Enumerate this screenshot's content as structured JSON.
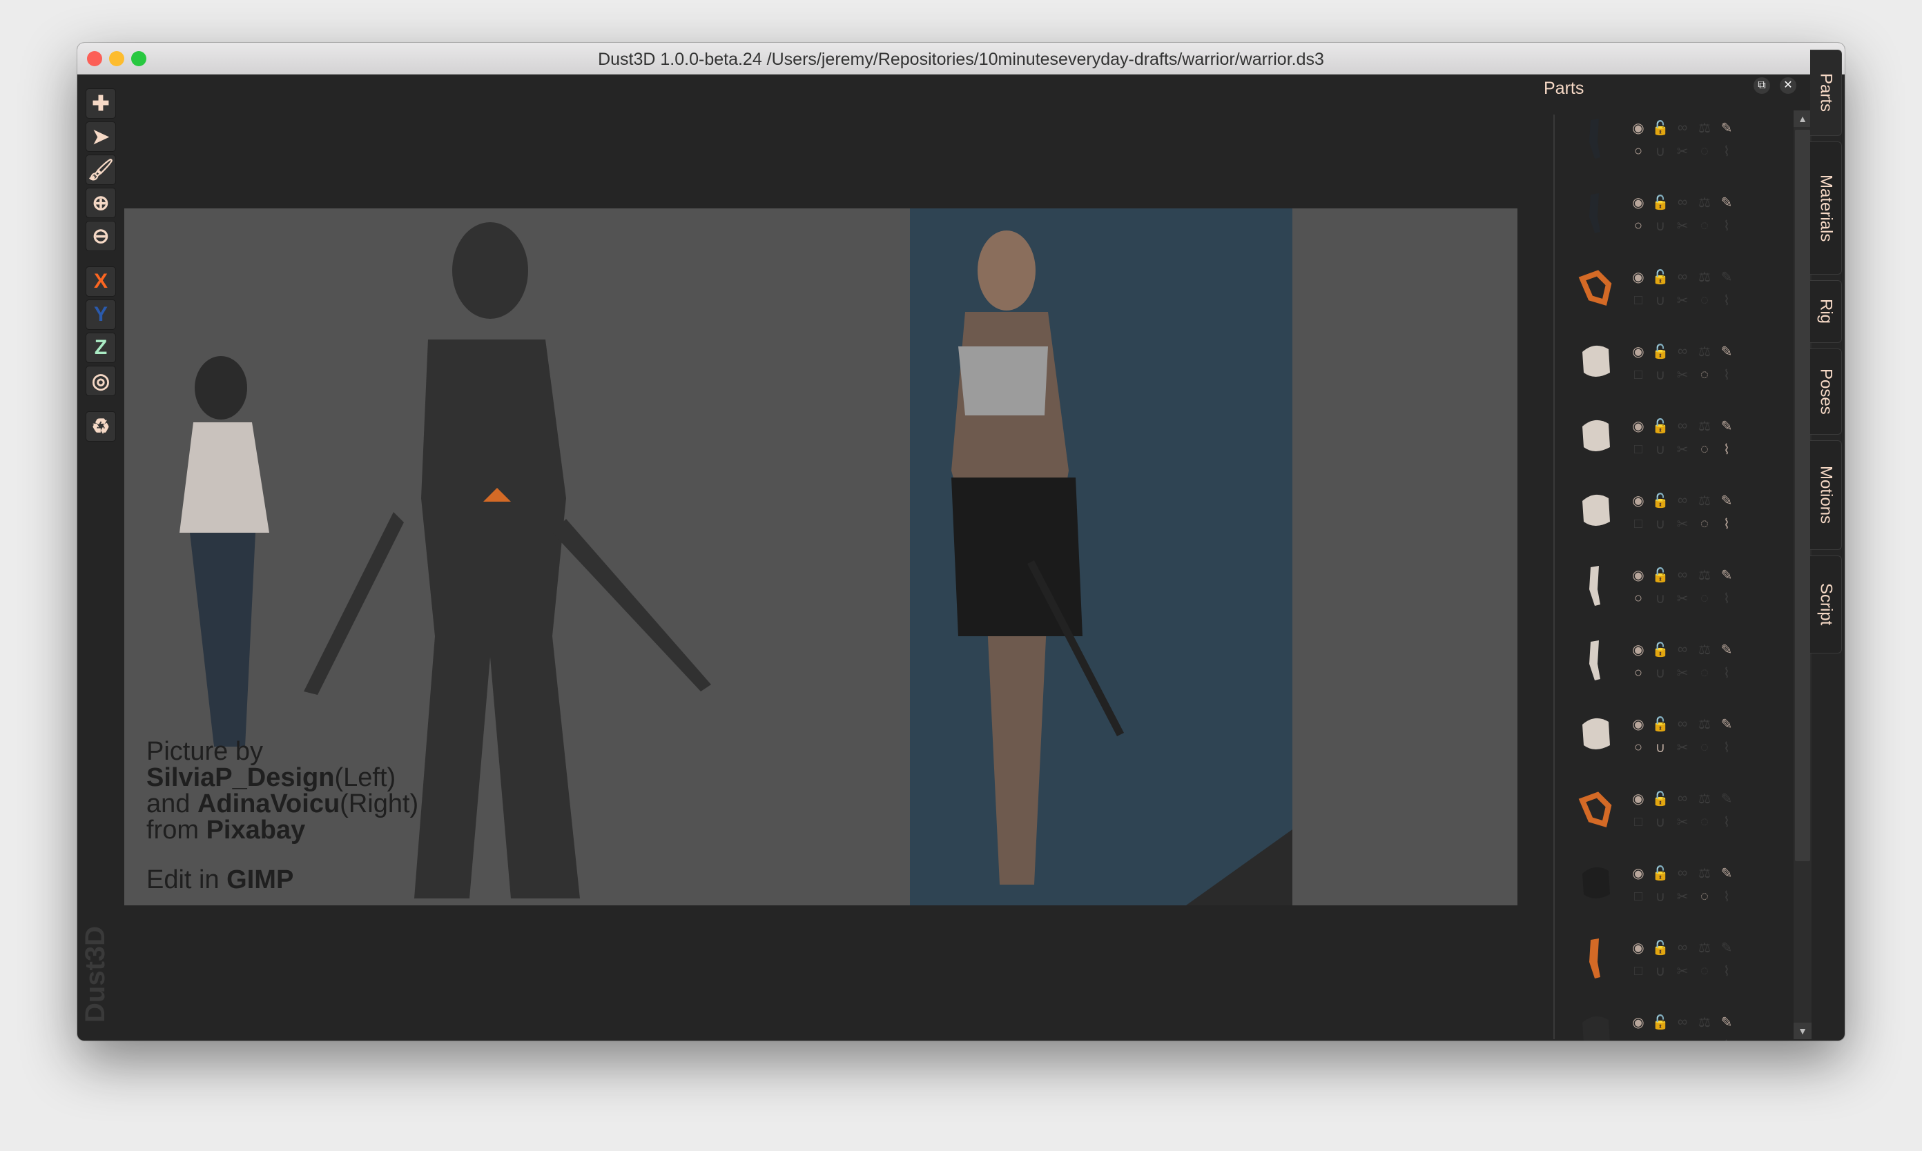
{
  "window": {
    "title": "Dust3D 1.0.0-beta.24 /Users/jeremy/Repositories/10minuteseveryday-drafts/warrior/warrior.ds3",
    "logo": "Dust3D"
  },
  "toolbar": {
    "buttons": [
      {
        "name": "add-icon",
        "glyph": "✚",
        "color": "#f6d9c6"
      },
      {
        "name": "select-pointer-icon",
        "glyph": "➤",
        "color": "#f6d9c6"
      },
      {
        "name": "paint-brush-icon",
        "glyph": "🖌",
        "color": "#f6d9c6"
      },
      {
        "name": "zoom-in-icon",
        "glyph": "⊕",
        "color": "#f6d9c6"
      },
      {
        "name": "zoom-out-icon",
        "glyph": "⊖",
        "color": "#f6d9c6"
      }
    ],
    "axes": [
      {
        "label": "X",
        "color": "#fc6621"
      },
      {
        "label": "Y",
        "color": "#2a5aac"
      },
      {
        "label": "Z",
        "color": "#aaebc4"
      }
    ],
    "extra": [
      {
        "name": "radius-target-icon",
        "glyph": "◎"
      },
      {
        "name": "recycle-icon",
        "glyph": "♻"
      }
    ]
  },
  "canvas": {
    "credit": {
      "l1": "Picture by",
      "author1": "SilviaP_Design",
      "side1": "(Left)",
      "and": "and ",
      "author2": "AdinaVoicu",
      "side2": "(Right)",
      "from": "from ",
      "source": "Pixabay"
    },
    "edit_prefix": "Edit in ",
    "edit_tool": "GIMP"
  },
  "parts_panel": {
    "title": "Parts",
    "rows": [
      {
        "color": "#23272c",
        "shape": "arm",
        "first": "circle",
        "on": [
          0,
          4,
          5
        ]
      },
      {
        "color": "#23272c",
        "shape": "arm",
        "first": "circle",
        "on": [
          0,
          4,
          5
        ]
      },
      {
        "color": "#d46a26",
        "shape": "ring",
        "first": "square",
        "on": [
          0
        ]
      },
      {
        "color": "#d8cfc6",
        "shape": "blob",
        "first": "square",
        "on": [
          0,
          4,
          8
        ]
      },
      {
        "color": "#d8cfc6",
        "shape": "blob",
        "first": "square",
        "on": [
          0,
          4,
          8,
          9
        ]
      },
      {
        "color": "#d8cfc6",
        "shape": "blob",
        "first": "square",
        "on": [
          0,
          4,
          8,
          9
        ]
      },
      {
        "color": "#d8cfc6",
        "shape": "arm",
        "first": "circle",
        "on": [
          0,
          4,
          5
        ]
      },
      {
        "color": "#d8cfc6",
        "shape": "arm",
        "first": "circle",
        "on": [
          0,
          4,
          5
        ]
      },
      {
        "color": "#d8cfc6",
        "shape": "blob",
        "first": "circle",
        "on": [
          0,
          4,
          5,
          6
        ]
      },
      {
        "color": "#d46a26",
        "shape": "ring",
        "first": "square",
        "on": [
          0
        ]
      },
      {
        "color": "#1e1e1e",
        "shape": "blob",
        "first": "square",
        "on": [
          0,
          4,
          8
        ]
      },
      {
        "color": "#d46a26",
        "shape": "arm",
        "first": "square",
        "on": [
          0
        ]
      },
      {
        "color": "#2a2a2a",
        "shape": "blob",
        "first": "square",
        "on": [
          0,
          4
        ]
      }
    ]
  },
  "tabs": [
    "Parts",
    "Materials",
    "Rig",
    "Poses",
    "Motions",
    "Script"
  ]
}
